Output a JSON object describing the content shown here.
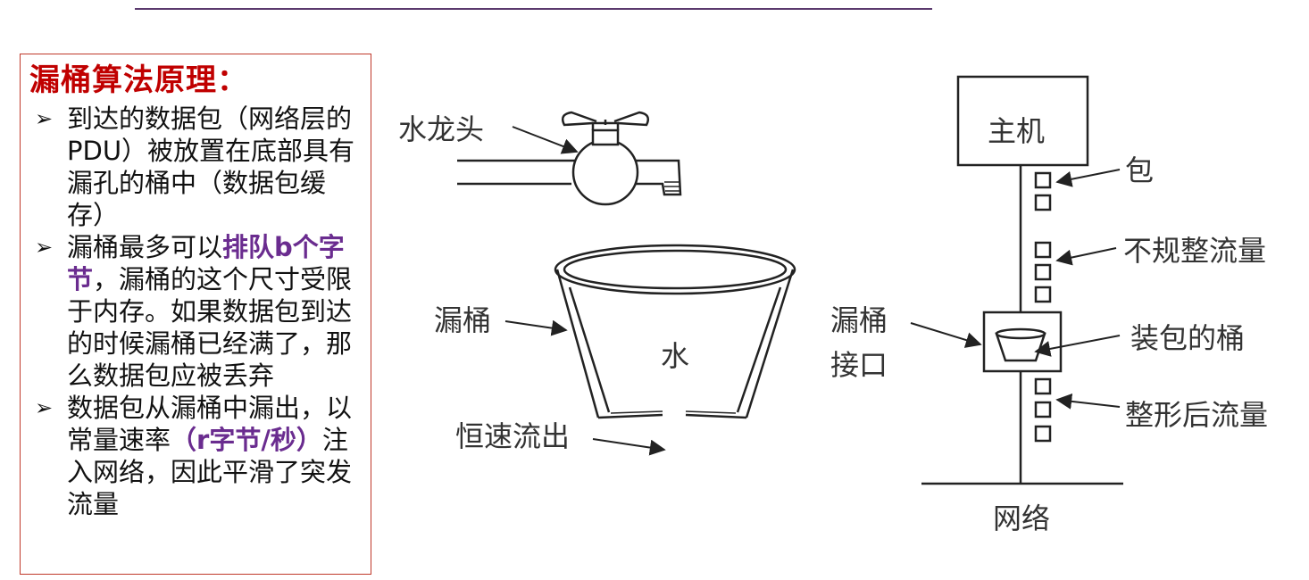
{
  "panel": {
    "title": "漏桶算法原理：",
    "bullets": [
      {
        "marker": "➢",
        "parts": [
          {
            "text": "到达的数据包（网络层的PDU）被放置在底部具有漏孔的桶中（数据包缓存）",
            "highlight": false
          }
        ]
      },
      {
        "marker": "➢",
        "parts": [
          {
            "text": "漏桶最多可以",
            "highlight": false
          },
          {
            "text": "排队b个字节",
            "highlight": true
          },
          {
            "text": "，漏桶的这个尺寸受限于内存。如果数据包到达的时候漏桶已经满了，那么数据包应被丢弃",
            "highlight": false
          }
        ]
      },
      {
        "marker": "➢",
        "parts": [
          {
            "text": "数据包从漏桶中漏出，以常量速率",
            "highlight": false
          },
          {
            "text": "（r字节/秒）",
            "highlight": true
          },
          {
            "text": "注入网络，因此平滑了突发流量",
            "highlight": false
          }
        ]
      }
    ]
  },
  "diagram": {
    "faucet_label": "水龙头",
    "bucket_label": "漏桶",
    "water_label": "水",
    "outflow_label": "恒速流出",
    "host_label": "主机",
    "packet_label": "包",
    "irregular_flow_label": "不规整流量",
    "interface_label_line1": "漏桶",
    "interface_label_line2": "接口",
    "bucket_with_packets_label": "装包的桶",
    "shaped_flow_label": "整形后流量",
    "network_label": "网络"
  },
  "colors": {
    "title_red": "#c00000",
    "highlight_purple": "#6a2c8f",
    "panel_border": "#c0392b",
    "top_rule": "#5b3a6e"
  }
}
